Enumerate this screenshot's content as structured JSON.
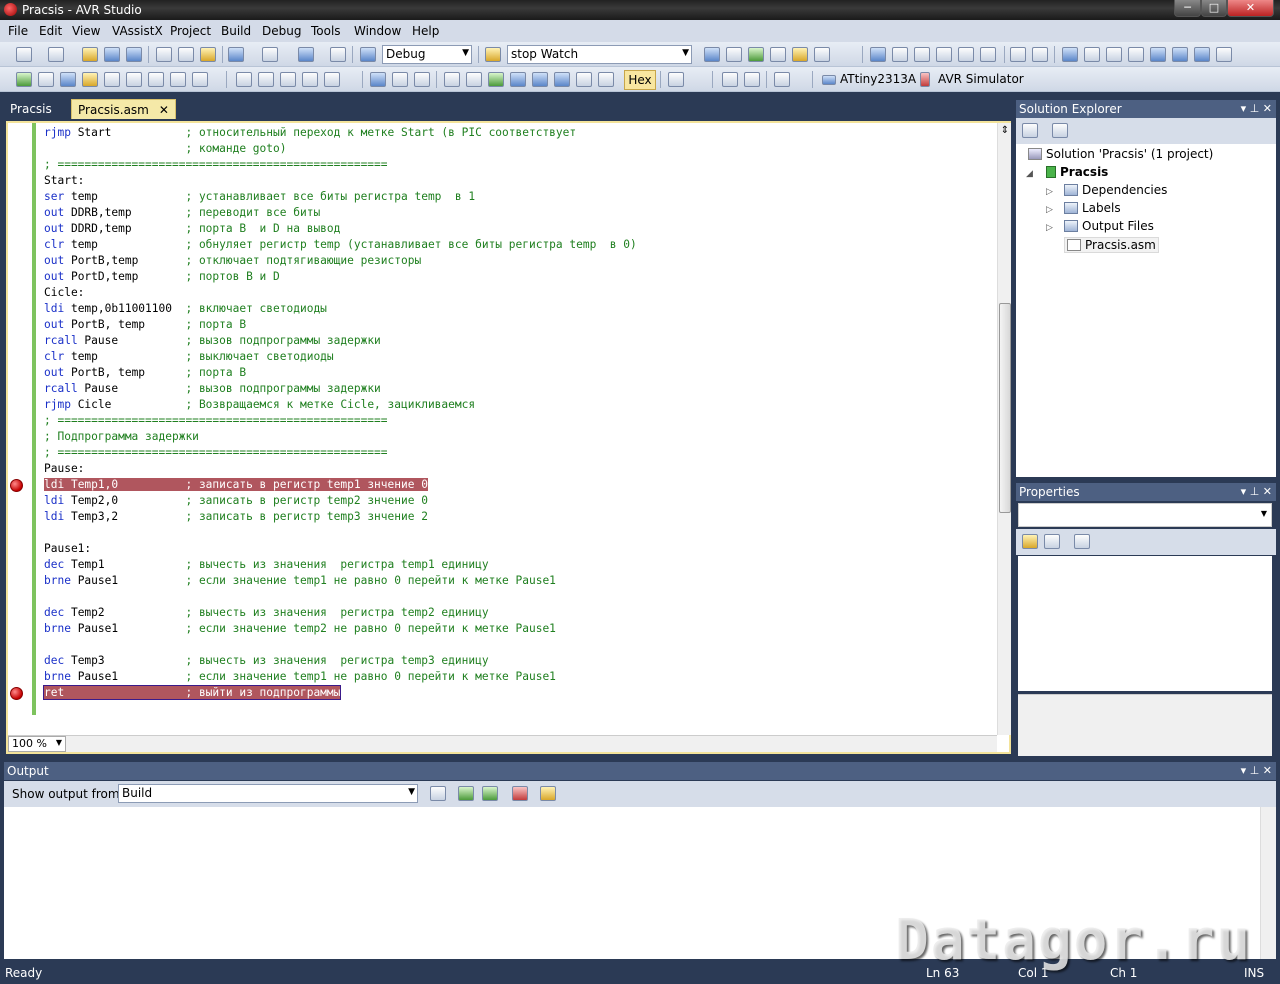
{
  "window": {
    "title": "Pracsis - AVR Studio",
    "min_glyph": "─",
    "max_glyph": "□",
    "close_glyph": "✕"
  },
  "menu": {
    "items": [
      "File",
      "Edit",
      "View",
      "VAssistX",
      "Project",
      "Build",
      "Debug",
      "Tools",
      "Window",
      "Help"
    ]
  },
  "toolbar": {
    "configuration": "Debug",
    "find_text": "stop Watch",
    "hex_label": "Hex",
    "device": "ATtiny2313A",
    "debugger": "AVR Simulator"
  },
  "tabs": [
    {
      "label": "Pracsis",
      "active": false
    },
    {
      "label": "Pracsis.asm",
      "active": true,
      "close": "✕"
    }
  ],
  "editor": {
    "zoom": "100 %",
    "lines": [
      {
        "kw": "rjmp",
        "arg": " Start           ",
        "comment": "; относительный переход к метке Start (в PIC соответствует"
      },
      {
        "kw": "",
        "arg": "                     ",
        "comment": "; команде goto)"
      },
      {
        "kw": "",
        "arg": "",
        "comment": "; ================================================="
      },
      {
        "kw": "",
        "arg": "Start:",
        "comment": ""
      },
      {
        "kw": "ser",
        "arg": " temp             ",
        "comment": "; устанавливает все биты регистра temp  в 1"
      },
      {
        "kw": "out",
        "arg": " DDRB,temp        ",
        "comment": "; переводит все биты"
      },
      {
        "kw": "out",
        "arg": " DDRD,temp        ",
        "comment": "; порта B  и D на вывод"
      },
      {
        "kw": "clr",
        "arg": " temp             ",
        "comment": "; обнуляет регистр temp (устанавливает все биты регистра temp  в 0)"
      },
      {
        "kw": "out",
        "arg": " PortB,temp       ",
        "comment": "; отключает подтягивающие резисторы"
      },
      {
        "kw": "out",
        "arg": " PortD,temp       ",
        "comment": "; портов B и D"
      },
      {
        "kw": "",
        "arg": "Cicle:",
        "comment": ""
      },
      {
        "kw": "ldi",
        "arg": " temp,0b11001100  ",
        "comment": "; включает светодиоды"
      },
      {
        "kw": "out",
        "arg": " PortB, temp      ",
        "comment": "; порта B"
      },
      {
        "kw": "rcall",
        "arg": " Pause          ",
        "comment": "; вызов подпрограммы задержки"
      },
      {
        "kw": "clr",
        "arg": " temp             ",
        "comment": "; выключает светодиоды"
      },
      {
        "kw": "out",
        "arg": " PortB, temp      ",
        "comment": "; порта B"
      },
      {
        "kw": "rcall",
        "arg": " Pause          ",
        "comment": "; вызов подпрограммы задержки"
      },
      {
        "kw": "rjmp",
        "arg": " Cicle           ",
        "comment": "; Возвращаемся к метке Cicle, зацикливаемся"
      },
      {
        "kw": "",
        "arg": "",
        "comment": "; ================================================="
      },
      {
        "kw": "",
        "arg": "",
        "comment": "; Подпрограмма задержки"
      },
      {
        "kw": "",
        "arg": "",
        "comment": "; ================================================="
      },
      {
        "kw": "",
        "arg": "Pause:",
        "comment": ""
      },
      {
        "kw": "ldi",
        "arg": " Temp1,0          ",
        "comment": "; записать в регистр temp1 знчение 0",
        "hl": "red",
        "bp": true
      },
      {
        "kw": "ldi",
        "arg": " Temp2,0          ",
        "comment": "; записать в регистр temp2 знчение 0"
      },
      {
        "kw": "ldi",
        "arg": " Temp3,2          ",
        "comment": "; записать в регистр temp3 знчение 2"
      },
      {
        "kw": "",
        "arg": "",
        "comment": ""
      },
      {
        "kw": "",
        "arg": "Pause1:",
        "comment": ""
      },
      {
        "kw": "dec",
        "arg": " Temp1            ",
        "comment": "; вычесть из значения  регистра temp1 единицу"
      },
      {
        "kw": "brne",
        "arg": " Pause1          ",
        "comment": "; если значение temp1 не равно 0 перейти к метке Pause1"
      },
      {
        "kw": "",
        "arg": "",
        "comment": ""
      },
      {
        "kw": "dec",
        "arg": " Temp2            ",
        "comment": "; вычесть из значения  регистра temp2 единицу"
      },
      {
        "kw": "brne",
        "arg": " Pause1          ",
        "comment": "; если значение temp2 не равно 0 перейти к метке Pause1"
      },
      {
        "kw": "",
        "arg": "",
        "comment": ""
      },
      {
        "kw": "dec",
        "arg": " Temp3            ",
        "comment": "; вычесть из значения  регистра temp3 единицу"
      },
      {
        "kw": "brne",
        "arg": " Pause1          ",
        "comment": "; если значение temp1 не равно 0 перейти к метке Pause1"
      },
      {
        "kw": "ret",
        "arg": "                  ",
        "comment": "; выйти из подпрограммы",
        "hl": "red-box",
        "bp": true
      }
    ]
  },
  "solution_explorer": {
    "title": "Solution Explorer",
    "title_ctrls": "▾ ⊥ ✕",
    "solution": "Solution 'Pracsis' (1 project)",
    "project": "Pracsis",
    "folders": [
      "Dependencies",
      "Labels",
      "Output Files"
    ],
    "file": "Pracsis.asm"
  },
  "properties": {
    "title": "Properties",
    "title_ctrls": "▾ ⊥ ✕"
  },
  "output": {
    "title": "Output",
    "title_ctrls": "▾ ⊥ ✕",
    "show_from_label": "Show output from:",
    "source": "Build"
  },
  "statusbar": {
    "ready": "Ready",
    "ln": "Ln 63",
    "col": "Col 1",
    "ch": "Ch 1",
    "mode": "INS"
  },
  "watermark": "Datagor.ru"
}
